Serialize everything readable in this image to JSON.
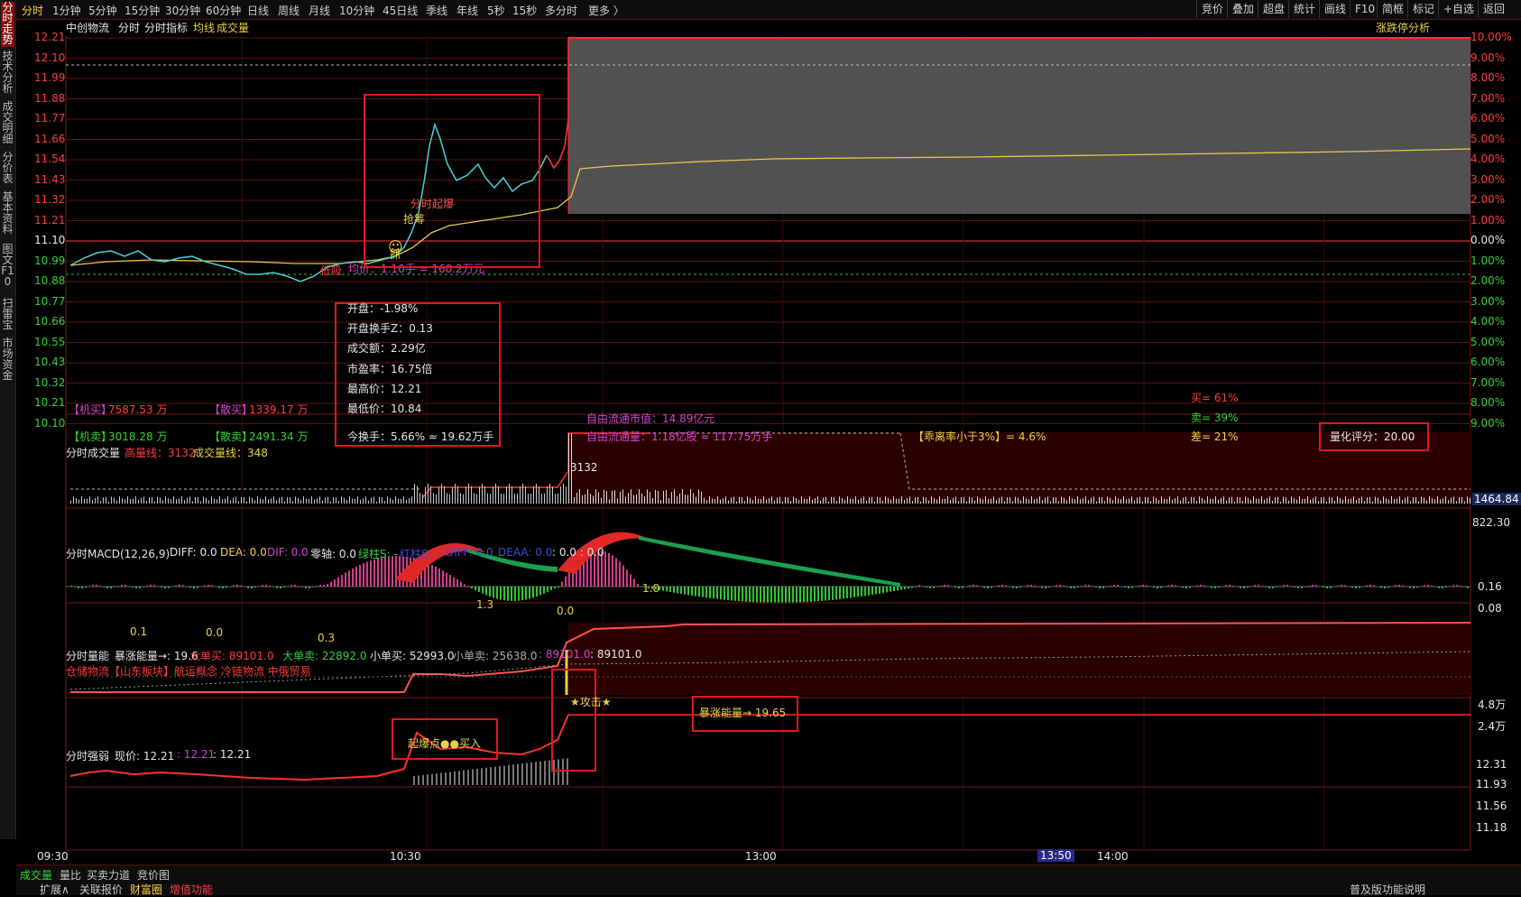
{
  "left_tabs": [
    "分时走势",
    "技术分析",
    "成交明细",
    "分价表",
    "基本资料",
    "图文F10",
    "扫雷宝",
    "市场资金"
  ],
  "top_tabs": [
    "分时",
    "1分钟",
    "5分钟",
    "15分钟",
    "30分钟",
    "60分钟",
    "日线",
    "周线",
    "月线",
    "10分钟",
    "45日线",
    "季线",
    "年线",
    "5秒",
    "15秒",
    "多分时",
    "更多 〉"
  ],
  "right_buttons": [
    "竞价",
    "叠加",
    "超盘",
    "统计",
    "画线",
    "F10",
    "简框",
    "标记",
    "+自选",
    "返回"
  ],
  "header": {
    "stock": "中创物流",
    "mode": "分时",
    "indicator": "分时指标",
    "avg": "均线",
    "vol": "成交量",
    "right_label": "涨跌停分析"
  },
  "price_axis": [
    "12.21",
    "12.10",
    "11.99",
    "11.88",
    "11.77",
    "11.66",
    "11.54",
    "11.43",
    "11.32",
    "11.21",
    "11.10",
    "10.99",
    "10.88",
    "10.77",
    "10.66",
    "10.55",
    "10.43",
    "10.32",
    "10.21",
    "10.10"
  ],
  "pct_axis": [
    "10.00%",
    "9.00%",
    "8.00%",
    "7.00%",
    "6.00%",
    "5.00%",
    "4.00%",
    "3.00%",
    "2.00%",
    "1.00%",
    "0.00%",
    "1.00%",
    "2.00%",
    "3.00%",
    "4.00%",
    "5.00%",
    "6.00%",
    "7.00%",
    "8.00%",
    "9.00%"
  ],
  "annotations": {
    "breakout": "分时起爆",
    "rush": "抢筹",
    "grab": "抓",
    "lure": "诱",
    "low": "低吸",
    "low_stat": "均价：1.10手 = 160.2万元"
  },
  "info_panel": {
    "open": "开盘：-1.98%",
    "open_turn": "开盘换手Z：0.13",
    "amount": "成交额：2.29亿",
    "pe": "市盈率：16.75倍",
    "high": "最高价：12.21",
    "low": "最低价：10.84",
    "turnover": "今换手：5.66% ≈ 19.62万手"
  },
  "flow": {
    "inst_buy_label": "【机买】",
    "inst_buy": "7587.53 万",
    "retail_buy_label": "【散买】",
    "retail_buy": "1339.17 万",
    "inst_sell_label": "【机卖】",
    "inst_sell": "3018.28 万",
    "retail_sell_label": "【散卖】",
    "retail_sell": "2491.34 万",
    "float_cap": "自由流通市值：14.89亿元",
    "float_shares": "自由流通量：1.18亿股 ≈ 117.75万手",
    "deviation": "【乖离率小于3%】= 4.6%",
    "buy_pct": "买= 61%",
    "sell_pct": "卖= 39%",
    "diff_pct": "差= 21%",
    "score": "量化评分：20.00"
  },
  "vol_panel": {
    "title": "分时成交量",
    "high_label": "高量线：3132",
    "vol_label": "成交量线：348",
    "peak": "3132",
    "axis": [
      "1464.84",
      "822.30"
    ]
  },
  "macd_panel": {
    "title": "分时MACD(12,26,9)",
    "diff": "DIFF: 0.0",
    "dea": "DEA: 0.0",
    "dif": "DIF: 0.0",
    "zero": "零轴: 0.0",
    "green": "绿柱S: -",
    "red": "红柱S: -",
    "diffb": "DIFF: 0.0",
    "deaa": "DEAA: 0.0",
    "tail": ": 0.0 : 0.0",
    "axis": [
      "0.16",
      "0.08"
    ],
    "marks": [
      "0.1",
      "0.0",
      "0.3",
      "1.3",
      "0.0",
      "1.0"
    ]
  },
  "energy_panel": {
    "title": "分时量能",
    "surge": "暴涨能量→: 19.6",
    "big_buy": "大单买: 89101.0",
    "big_sell": "大单卖: 22892.0",
    "small_buy": "小单买: 52993.0",
    "small_sell": "小单卖: 25638.0",
    "v1": ": 89101.0",
    "v2": ": 89101.0",
    "concepts": "仓储物流【山东板块】航运概念 冷链物流 中俄贸易",
    "start_buy": "起爆点●●买入",
    "attack": "★攻击★",
    "surge_box": "暴涨能量→ 19.65",
    "axis": [
      "4.8万",
      "2.4万"
    ]
  },
  "strength_panel": {
    "title": "分时强弱",
    "price": "现价: 12.21",
    "v1": ": 12.21",
    "v2": ": 12.21",
    "axis": [
      "12.31",
      "11.93",
      "11.56",
      "11.18"
    ]
  },
  "time_axis": [
    "09:30",
    "10:30",
    "13:00",
    "13:50",
    "14:00"
  ],
  "bottom_tabs": [
    "成交量",
    "量比",
    "买卖力道",
    "竞价图"
  ],
  "bottom_tabs2": [
    "扩展∧",
    "关联报价",
    "财富圈",
    "增值功能"
  ],
  "bottom_right": "普及版功能说明",
  "colors": {
    "price": "#48d2d2",
    "avg": "#e6c850",
    "accent": "#e01818",
    "green": "#2ec82e"
  }
}
